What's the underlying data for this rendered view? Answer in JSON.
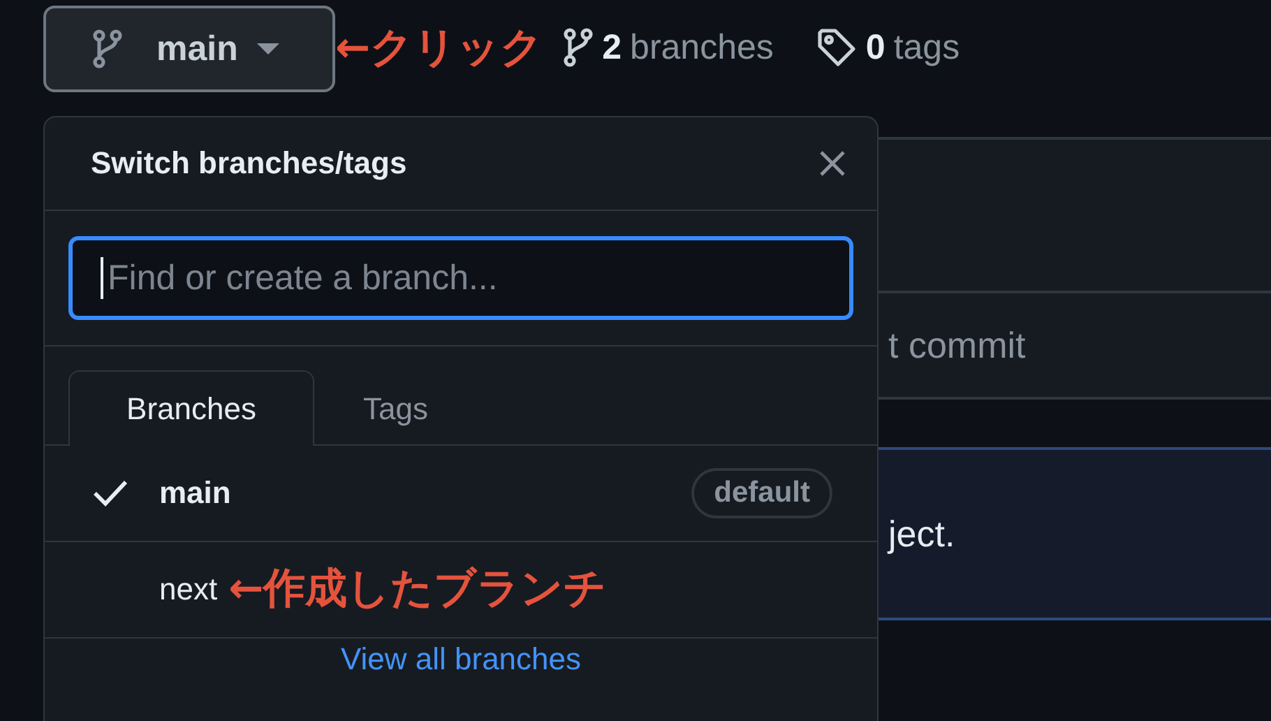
{
  "top_bar": {
    "branch_button": {
      "label": "main"
    },
    "annotation": "←クリック",
    "branches_link": {
      "count": "2",
      "label": "branches"
    },
    "tags_link": {
      "count": "0",
      "label": "tags"
    }
  },
  "background": {
    "commit_text": "t commit",
    "description_text": "ject."
  },
  "dropdown": {
    "title": "Switch branches/tags",
    "search": {
      "placeholder": "Find or create a branch...",
      "focused": true
    },
    "tabs": [
      {
        "label": "Branches",
        "selected": true
      },
      {
        "label": "Tags",
        "selected": false
      }
    ],
    "branches": [
      {
        "name": "main",
        "selected": true,
        "badge": "default"
      },
      {
        "name": "next",
        "selected": false,
        "annotation": "←作成したブランチ"
      }
    ],
    "footer_link": "View all branches"
  }
}
